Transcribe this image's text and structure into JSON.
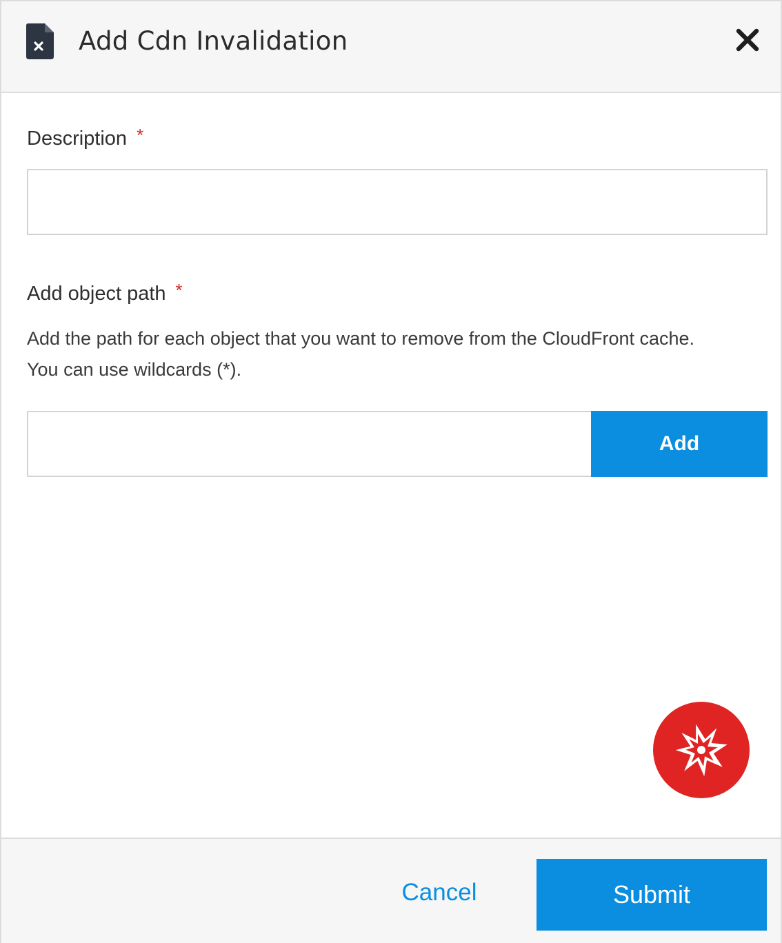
{
  "dialog": {
    "title": "Add Cdn Invalidation",
    "title_icon": "file-x-icon",
    "close_icon": "close-icon"
  },
  "form": {
    "description": {
      "label": "Description",
      "required_marker": "*",
      "value": "",
      "placeholder": ""
    },
    "object_path": {
      "label": "Add object path",
      "required_marker": "*",
      "help_text": "Add the path for each object that you want to remove from the CloudFront cache. You can use wildcards (*).",
      "value": "",
      "placeholder": "",
      "add_label": "Add"
    }
  },
  "fab": {
    "icon": "assistant-star-icon",
    "color": "#e02424"
  },
  "footer": {
    "cancel_label": "Cancel",
    "submit_label": "Submit"
  },
  "colors": {
    "accent": "#0b8ee0",
    "required": "#d42b2b",
    "header_bg": "#f6f6f6"
  }
}
